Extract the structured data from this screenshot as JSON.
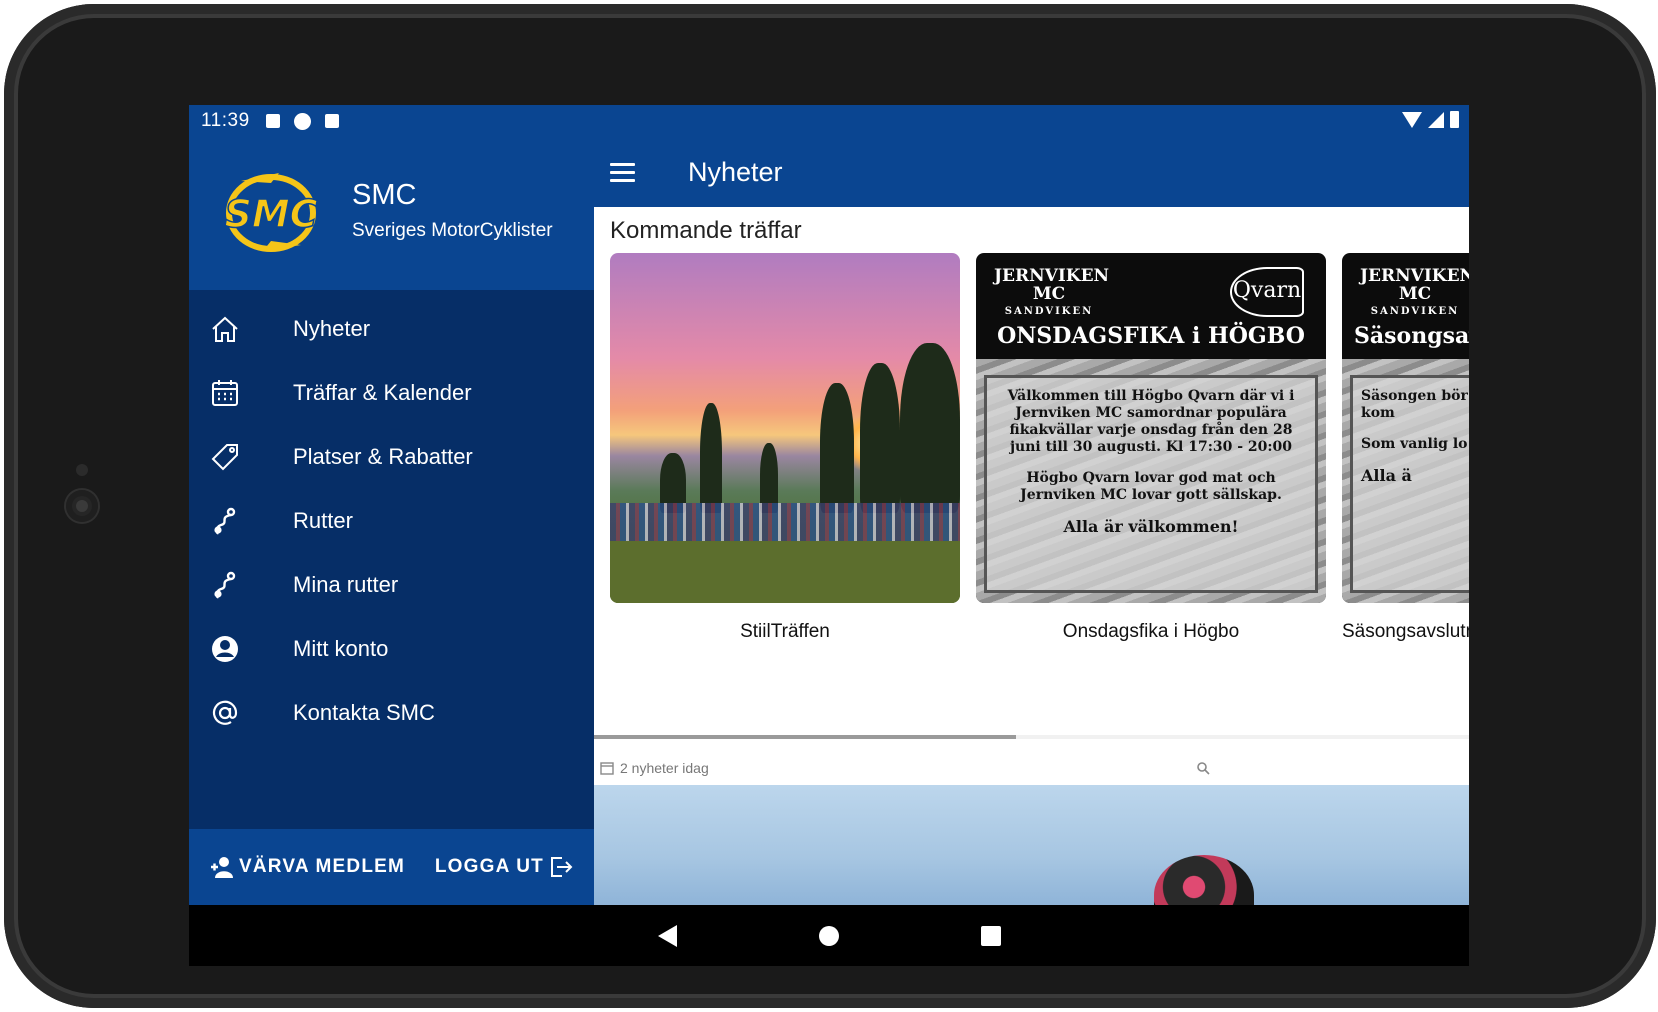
{
  "status_bar": {
    "time": "11:39"
  },
  "drawer": {
    "app_name": "SMC",
    "app_subtitle": "Sveriges MotorCyklister",
    "logo_text": "SMC",
    "items": [
      {
        "label": "Nyheter",
        "icon": "home-icon"
      },
      {
        "label": "Träffar & Kalender",
        "icon": "calendar-icon"
      },
      {
        "label": "Platser & Rabatter",
        "icon": "tag-icon"
      },
      {
        "label": "Rutter",
        "icon": "route-icon"
      },
      {
        "label": "Mina rutter",
        "icon": "route-icon"
      },
      {
        "label": "Mitt konto",
        "icon": "account-icon"
      },
      {
        "label": "Kontakta SMC",
        "icon": "at-icon"
      }
    ],
    "footer": {
      "recruit_label": "VÄRVA MEDLEM",
      "logout_label": "LOGGA UT"
    }
  },
  "main": {
    "title": "Nyheter",
    "section_title": "Kommande träffar",
    "events": [
      {
        "label": "StiilTräffen"
      },
      {
        "label": "Onsdagsfika i Högbo",
        "poster": {
          "club": "JERNVIKEN MC",
          "club_sub": "SANDVIKEN",
          "brand": "Qvarn",
          "headline": "ONSDAGSFIKA i HÖGBO",
          "text1": "Välkommen till Högbo Qvarn där vi i Jernviken MC samordnar populära fikakvällar varje onsdag från den 28 juni till 30 augusti. Kl 17:30 - 20:00",
          "text2": "Högbo Qvarn lovar god mat och Jernviken MC lovar gott sällskap.",
          "closing": "Alla är välkommen!"
        }
      },
      {
        "label": "Säsongsavslutn",
        "poster": {
          "club": "JERNVIKEN MC",
          "club_sub": "SANDVIKEN",
          "headline": "Säsongsav",
          "text1": "Säsongen bör avslutar med Mer info kom",
          "text2": "Som vanlig lo och Jernvike",
          "closing": "Alla ä"
        }
      }
    ],
    "news_count": "2 nyheter idag"
  },
  "colors": {
    "primary": "#0a4591",
    "drawer_bg": "#062e67",
    "logo_yellow": "#f5c518"
  }
}
